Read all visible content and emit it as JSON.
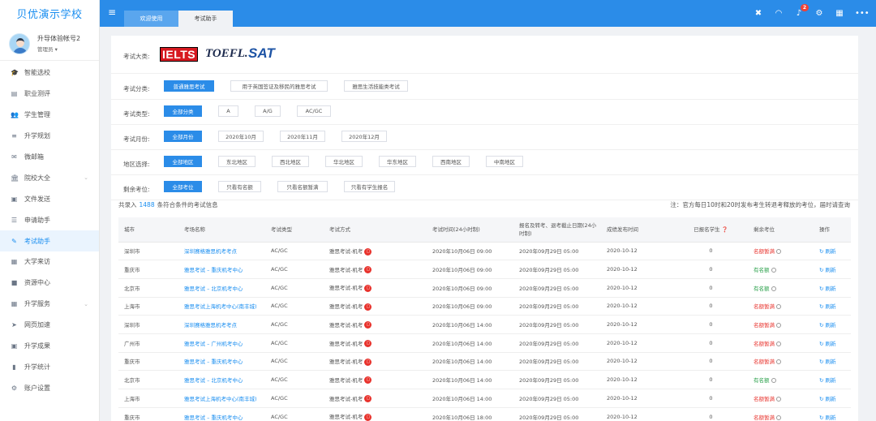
{
  "brand": "贝优演示学校",
  "user": {
    "name": "升导体验帐号2",
    "role": "管理员"
  },
  "nav": [
    {
      "label": "智能选校",
      "icon": "graduation-cap-icon",
      "glyph": "🎓"
    },
    {
      "label": "职业测评",
      "icon": "clipboard-icon",
      "glyph": "▤"
    },
    {
      "label": "学生管理",
      "icon": "users-icon",
      "glyph": "👥"
    },
    {
      "label": "升学规划",
      "icon": "list-icon",
      "glyph": "≡"
    },
    {
      "label": "微邮箱",
      "icon": "envelope-icon",
      "glyph": "✉"
    },
    {
      "label": "院校大全",
      "icon": "university-icon",
      "glyph": "🏛",
      "chevron": "⌄"
    },
    {
      "label": "文件发送",
      "icon": "file-icon",
      "glyph": "▣"
    },
    {
      "label": "申请助手",
      "icon": "list-icon",
      "glyph": "☰"
    },
    {
      "label": "考试助手",
      "icon": "edit-icon",
      "glyph": "✎",
      "active": true
    },
    {
      "label": "大学来访",
      "icon": "calendar-icon",
      "glyph": "▦"
    },
    {
      "label": "资源中心",
      "icon": "briefcase-icon",
      "glyph": "■"
    },
    {
      "label": "升学服务",
      "icon": "grid-icon",
      "glyph": "▦",
      "chevron": "⌄"
    },
    {
      "label": "网页加速",
      "icon": "send-icon",
      "glyph": "➤"
    },
    {
      "label": "升学成果",
      "icon": "id-card-icon",
      "glyph": "▣"
    },
    {
      "label": "升学统计",
      "icon": "bar-chart-icon",
      "glyph": "▮"
    },
    {
      "label": "账户设置",
      "icon": "gear-icon",
      "glyph": "⚙"
    }
  ],
  "topbar": {
    "tabs": [
      "欢迎使用",
      "考试助手"
    ],
    "notification_count": "2"
  },
  "filters": {
    "exam_label": "考试大类:",
    "logos": [
      "IELTS",
      "TOEFL.",
      "SAT"
    ],
    "rows": [
      {
        "label": "考试分类:",
        "options": [
          {
            "text": "普通雅思考试",
            "w": 62,
            "selected": true
          },
          {
            "text": "用于英国签证及移民的雅思考试",
            "w": 120
          },
          {
            "text": "雅思生活技能类考试",
            "w": 79
          }
        ]
      },
      {
        "label": "考试类型:",
        "options": [
          {
            "text": "全部分类",
            "w": 47,
            "selected": true
          },
          {
            "text": "A",
            "w": 25
          },
          {
            "text": "A/G",
            "w": 32
          },
          {
            "text": "AC/GC",
            "w": 42
          }
        ]
      },
      {
        "label": "考试月份:",
        "options": [
          {
            "text": "全部月份",
            "w": 47,
            "selected": true
          },
          {
            "text": "2020年10月",
            "w": 56
          },
          {
            "text": "2020年11月",
            "w": 56
          },
          {
            "text": "2020年12月",
            "w": 56
          }
        ]
      },
      {
        "label": "地区选择:",
        "options": [
          {
            "text": "全部地区",
            "w": 47,
            "selected": true
          },
          {
            "text": "东北地区",
            "w": 46
          },
          {
            "text": "西北地区",
            "w": 46
          },
          {
            "text": "华北地区",
            "w": 46
          },
          {
            "text": "华东地区",
            "w": 46
          },
          {
            "text": "西南地区",
            "w": 46
          },
          {
            "text": "中南地区",
            "w": 46
          }
        ]
      },
      {
        "label": "剩余考位:",
        "options": [
          {
            "text": "全部考位",
            "w": 47,
            "selected": true
          },
          {
            "text": "只看有名额",
            "w": 53
          },
          {
            "text": "只看名额暂满",
            "w": 62
          },
          {
            "text": "只看有学生报名",
            "w": 63
          }
        ]
      }
    ]
  },
  "summary": {
    "prefix": "共录入",
    "count": "1488",
    "suffix": "条符合条件的考试信息"
  },
  "note": "注：官方每日10时和20时发布考生转退考释放的考位，届时请查询",
  "table": {
    "headers": [
      "城市",
      "考场名称",
      "考试类型",
      "考试方式",
      "考试时间(24小时制)",
      "报名及转考、退考截止日期(24小时制)",
      "成绩发布时间",
      "已报名学生 ❓",
      "剩余考位",
      "操作"
    ],
    "rows": [
      [
        "深圳市",
        "深圳赛格雅思机考考点",
        "AC/GC",
        "雅思考试-机考",
        "2020年10月06日 09:00",
        "2020年09月29日 05:00",
        "2020-10-12",
        "0",
        "名额暂满",
        "刷新"
      ],
      [
        "重庆市",
        "雅思考试 – 重庆机考中心",
        "AC/GC",
        "雅思考试-机考",
        "2020年10月06日 09:00",
        "2020年09月29日 05:00",
        "2020-10-12",
        "0",
        "有名额",
        "刷新"
      ],
      [
        "北京市",
        "雅思考试 – 北京机考中心",
        "AC/GC",
        "雅思考试-机考",
        "2020年10月06日 09:00",
        "2020年09月29日 05:00",
        "2020-10-12",
        "0",
        "有名额",
        "刷新"
      ],
      [
        "上海市",
        "雅思考试上海机考中心(南丰城)",
        "AC/GC",
        "雅思考试-机考",
        "2020年10月06日 09:00",
        "2020年09月29日 05:00",
        "2020-10-12",
        "0",
        "名额暂满",
        "刷新"
      ],
      [
        "深圳市",
        "深圳赛格雅思机考考点",
        "AC/GC",
        "雅思考试-机考",
        "2020年10月06日 14:00",
        "2020年09月29日 05:00",
        "2020-10-12",
        "0",
        "名额暂满",
        "刷新"
      ],
      [
        "广州市",
        "雅思考试 – 广州机考中心",
        "AC/GC",
        "雅思考试-机考",
        "2020年10月06日 14:00",
        "2020年09月29日 05:00",
        "2020-10-12",
        "0",
        "名额暂满",
        "刷新"
      ],
      [
        "重庆市",
        "雅思考试 – 重庆机考中心",
        "AC/GC",
        "雅思考试-机考",
        "2020年10月06日 14:00",
        "2020年09月29日 05:00",
        "2020-10-12",
        "0",
        "名额暂满",
        "刷新"
      ],
      [
        "北京市",
        "雅思考试 – 北京机考中心",
        "AC/GC",
        "雅思考试-机考",
        "2020年10月06日 14:00",
        "2020年09月29日 05:00",
        "2020-10-12",
        "0",
        "有名额",
        "刷新"
      ],
      [
        "上海市",
        "雅思考试上海机考中心(南丰城)",
        "AC/GC",
        "雅思考试-机考",
        "2020年10月06日 14:00",
        "2020年09月29日 05:00",
        "2020-10-12",
        "0",
        "名额暂满",
        "刷新"
      ],
      [
        "重庆市",
        "雅思考试 – 重庆机考中心",
        "AC/GC",
        "雅思考试-机考",
        "2020年10月06日 18:00",
        "2020年09月29日 05:00",
        "2020-10-12",
        "0",
        "名额暂满",
        "刷新"
      ]
    ]
  },
  "colors": {
    "accent": "#2b8ce8",
    "full": "#e8322c",
    "available": "#2aa04a"
  }
}
